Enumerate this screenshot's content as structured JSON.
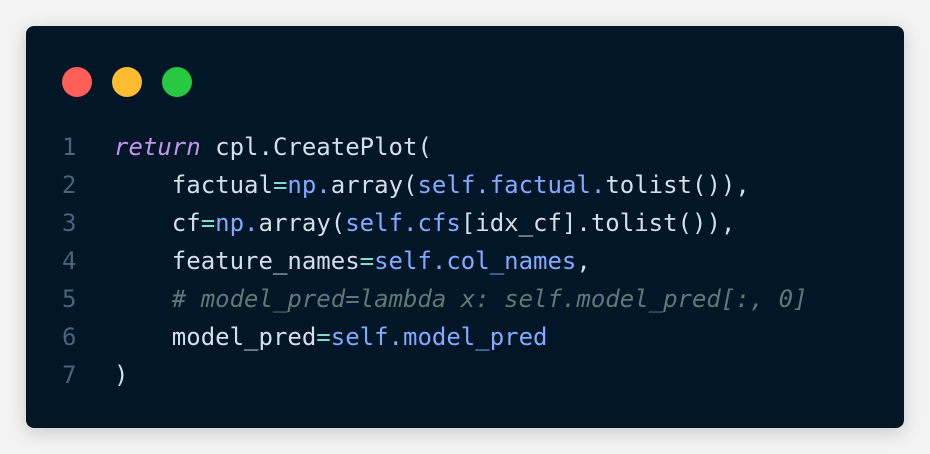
{
  "window_controls": [
    {
      "name": "close",
      "color": "#ff5f57"
    },
    {
      "name": "minimize",
      "color": "#febc2e"
    },
    {
      "name": "maximize",
      "color": "#28c840"
    }
  ],
  "colors": {
    "line_number": "#4b6479",
    "default": "#d6deeb",
    "keyword": "#c792ea",
    "operator": "#7fdbca",
    "self": "#82aaff",
    "comment": "#637777"
  },
  "code_lines": [
    {
      "number": "1",
      "tokens": [
        {
          "text": "return",
          "type": "keyword"
        },
        {
          "text": " cpl.CreatePlot(",
          "type": "default"
        }
      ]
    },
    {
      "number": "2",
      "tokens": [
        {
          "text": "    factual",
          "type": "default"
        },
        {
          "text": "=",
          "type": "operator"
        },
        {
          "text": "np.",
          "type": "self"
        },
        {
          "text": "array(",
          "type": "default"
        },
        {
          "text": "self.factual.",
          "type": "self"
        },
        {
          "text": "tolist()),",
          "type": "default"
        }
      ]
    },
    {
      "number": "3",
      "tokens": [
        {
          "text": "    cf",
          "type": "default"
        },
        {
          "text": "=",
          "type": "operator"
        },
        {
          "text": "np.",
          "type": "self"
        },
        {
          "text": "array(",
          "type": "default"
        },
        {
          "text": "self.cfs",
          "type": "self"
        },
        {
          "text": "[idx_cf].tolist()),",
          "type": "default"
        }
      ]
    },
    {
      "number": "4",
      "tokens": [
        {
          "text": "    feature_names",
          "type": "default"
        },
        {
          "text": "=",
          "type": "operator"
        },
        {
          "text": "self.col_names",
          "type": "self"
        },
        {
          "text": ",",
          "type": "default"
        }
      ]
    },
    {
      "number": "5",
      "tokens": [
        {
          "text": "    # model_pred=lambda x: self.model_pred[:, 0]",
          "type": "comment"
        }
      ]
    },
    {
      "number": "6",
      "tokens": [
        {
          "text": "    model_pred",
          "type": "default"
        },
        {
          "text": "=",
          "type": "operator"
        },
        {
          "text": "self.model_pred",
          "type": "self"
        }
      ]
    },
    {
      "number": "7",
      "tokens": [
        {
          "text": ")",
          "type": "default"
        }
      ]
    }
  ]
}
